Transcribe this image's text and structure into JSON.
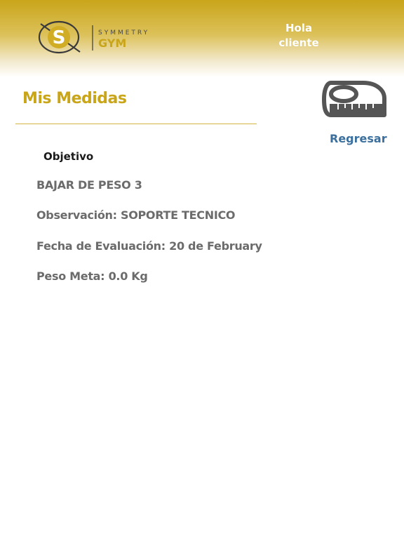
{
  "header": {
    "logo_top": "SYMMETRY",
    "logo_bottom": "GYM",
    "greeting_line1": "Hola",
    "greeting_line2": "cliente"
  },
  "page": {
    "title": "Mis Medidas",
    "back_label": "Regresar"
  },
  "objective": {
    "section_label": "Objetivo",
    "name": "BAJAR DE PESO 3",
    "observation_label": "Observación:",
    "observation_value": "SOPORTE TECNICO",
    "date_label": "Fecha de Evaluación:",
    "date_value": "20 de February",
    "target_label": "Peso Meta:",
    "target_value": "0.0 Kg"
  },
  "icons": {
    "logo": "symmetry-gym-logo-icon",
    "measure": "measuring-tape-icon"
  },
  "colors": {
    "brand_gold": "#c9a51a",
    "link_blue": "#3a6f9e",
    "text_gray": "#6b6b6b"
  }
}
